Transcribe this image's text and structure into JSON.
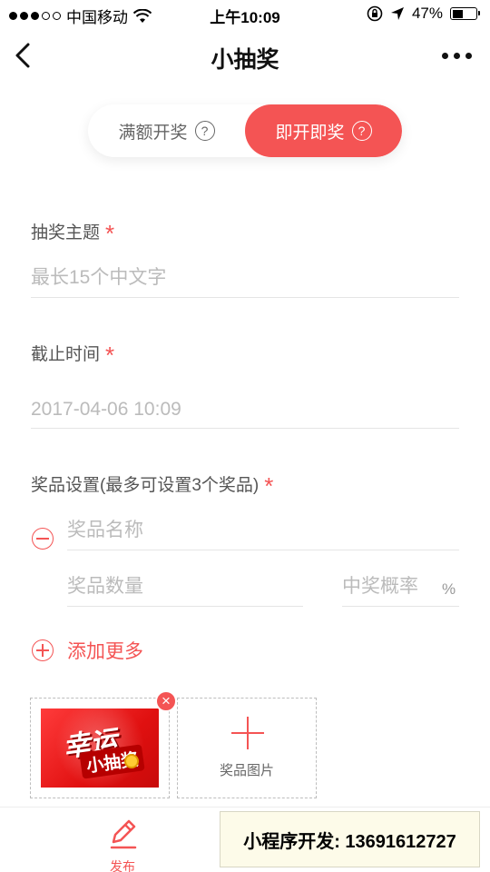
{
  "status_bar": {
    "carrier": "中国移动",
    "time": "上午10:09",
    "battery": "47%",
    "battery_level": 0.47
  },
  "nav": {
    "title": "小抽奖"
  },
  "mode_toggle": {
    "options": [
      "满额开奖",
      "即开即奖"
    ],
    "selected": "即开即奖",
    "help_mark": "?"
  },
  "form": {
    "topic": {
      "label": "抽奖主题",
      "required_mark": "*",
      "placeholder": "最长15个中文字"
    },
    "deadline": {
      "label": "截止时间",
      "required_mark": "*",
      "value": "2017-04-06  10:09"
    },
    "prizes": {
      "label": "奖品设置(最多可设置3个奖品)",
      "required_mark": "*",
      "name_placeholder": "奖品名称",
      "quantity_placeholder": "奖品数量",
      "rate_placeholder": "中奖概率",
      "rate_unit": "%",
      "add_more_label": "添加更多"
    },
    "image": {
      "prize_image_big_text": "幸运",
      "prize_image_small_text": "小抽奖",
      "remove_glyph": "×",
      "add_image_label": "奖品图片"
    }
  },
  "tabbar": {
    "publish_label": "发布"
  },
  "watermark": {
    "text": "小程序开发: 13691612727"
  },
  "colors": {
    "accent": "#f45454",
    "placeholder": "#bbbbbb"
  }
}
